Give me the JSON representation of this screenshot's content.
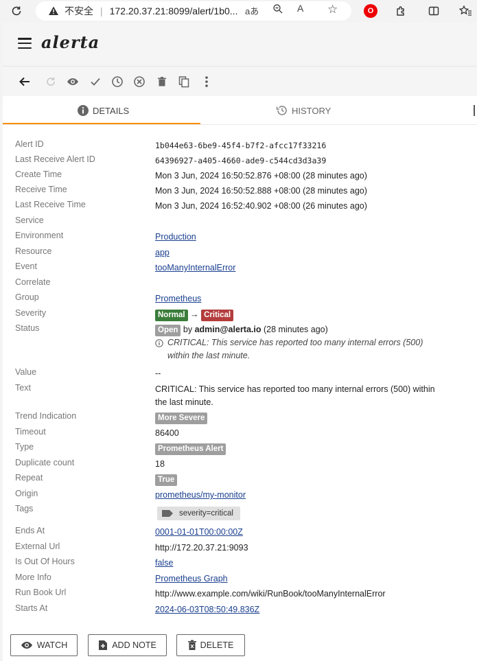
{
  "browser": {
    "insecure_label": "不安全",
    "url": "172.20.37.21:8099/alert/1b0...",
    "reader_glyph": "aあ",
    "read_aloud_glyph": "A",
    "shield_text": "O"
  },
  "app": {
    "logo": "alerta"
  },
  "tabs": [
    {
      "label": "DETAILS"
    },
    {
      "label": "HISTORY"
    }
  ],
  "details": {
    "alert_id": {
      "label": "Alert ID",
      "value": "1b044e63-6be9-45f4-b7f2-afcc17f33216"
    },
    "last_receive_alert_id": {
      "label": "Last Receive Alert ID",
      "value": "64396927-a405-4660-ade9-c544cd3d3a39"
    },
    "create_time": {
      "label": "Create Time",
      "value": "Mon 3 Jun, 2024 16:50:52.876 +08:00 (28 minutes ago)"
    },
    "receive_time": {
      "label": "Receive Time",
      "value": "Mon 3 Jun, 2024 16:50:52.888 +08:00 (28 minutes ago)"
    },
    "last_receive_time": {
      "label": "Last Receive Time",
      "value": "Mon 3 Jun, 2024 16:52:40.902 +08:00 (26 minutes ago)"
    },
    "service": {
      "label": "Service",
      "value": ""
    },
    "environment": {
      "label": "Environment",
      "value": "Production"
    },
    "resource": {
      "label": "Resource",
      "value": "app"
    },
    "event": {
      "label": "Event",
      "value": "tooManyInternalError"
    },
    "correlate": {
      "label": "Correlate",
      "value": ""
    },
    "group": {
      "label": "Group",
      "value": "Prometheus"
    },
    "severity": {
      "label": "Severity",
      "from": "Normal",
      "arrow": "→",
      "to": "Critical"
    },
    "status": {
      "label": "Status",
      "badge": "Open",
      "by": "by",
      "user": "admin@alerta.io",
      "ago": "(28 minutes ago)",
      "note": "CRITICAL: This service has reported too many internal errors (500) within the last minute."
    },
    "value": {
      "label": "Value",
      "value": "--"
    },
    "text": {
      "label": "Text",
      "value": "CRITICAL: This service has reported too many internal errors (500) within the last minute."
    },
    "trend": {
      "label": "Trend Indication",
      "value": "More Severe"
    },
    "timeout": {
      "label": "Timeout",
      "value": "86400"
    },
    "type": {
      "label": "Type",
      "value": "Prometheus Alert"
    },
    "duplicate": {
      "label": "Duplicate count",
      "value": "18"
    },
    "repeat": {
      "label": "Repeat",
      "value": "True"
    },
    "origin": {
      "label": "Origin",
      "value": "prometheus/my-monitor"
    },
    "tags": {
      "label": "Tags",
      "value": "severity=critical"
    },
    "ends_at": {
      "label": "Ends At",
      "value": "0001-01-01T00:00:00Z"
    },
    "external_url": {
      "label": "External Url",
      "value": "http://172.20.37.21:9093"
    },
    "out_of_hours": {
      "label": "Is Out Of Hours",
      "value": "false"
    },
    "more_info": {
      "label": "More Info",
      "value": "Prometheus Graph"
    },
    "run_book": {
      "label": "Run Book Url",
      "value": "http://www.example.com/wiki/RunBook/tooManyInternalError"
    },
    "starts_at": {
      "label": "Starts At",
      "value": "2024-06-03T08:50:49.836Z"
    }
  },
  "actions": {
    "watch": "WATCH",
    "add_note": "ADD NOTE",
    "delete": "DELETE"
  },
  "colors": {
    "accent": "#fb8c00",
    "normal": "#3a7d3a",
    "critical": "#b43c3c",
    "link": "#1a3f8f"
  }
}
